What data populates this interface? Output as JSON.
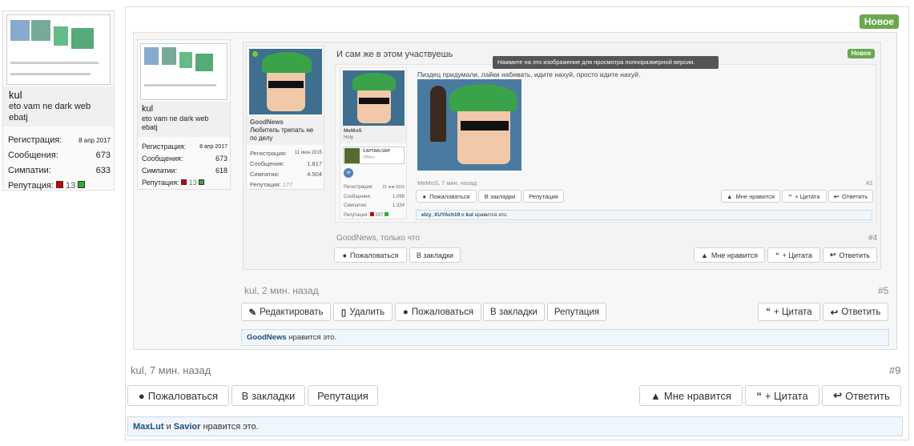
{
  "outer": {
    "badge_new": "Новое",
    "author": {
      "name": "kul",
      "title": "eto vam ne dark web ebatj",
      "stats": [
        {
          "label": "Регистрация:",
          "value": "8 апр 2017"
        },
        {
          "label": "Сообщения:",
          "value": "673"
        },
        {
          "label": "Симпатии:",
          "value": "633"
        }
      ],
      "reputation_label": "Репутация:",
      "reputation_value": "13"
    },
    "footer": {
      "meta": "kul, 7 мин. назад",
      "post_num": "#9",
      "buttons_left": [
        "Пожаловаться",
        "В закладки",
        "Репутация"
      ],
      "buttons_right": [
        "Мне нравится",
        "+ Цитата",
        "Ответить"
      ],
      "likes_users": [
        "MaxLut",
        "Savior"
      ],
      "likes_and": "и",
      "likes_suffix": "нравится это."
    }
  },
  "level2": {
    "author": {
      "name": "kul",
      "title": "eto vam ne dark web ebatj",
      "stats": [
        {
          "label": "Регистрация:",
          "value": "8 апр 2017"
        },
        {
          "label": "Сообщения:",
          "value": "673"
        },
        {
          "label": "Симпатии:",
          "value": "618"
        }
      ],
      "reputation_label": "Репутация:",
      "reputation_value": "13"
    },
    "footer": {
      "meta": "kul, 2 мин. назад",
      "post_num": "#5",
      "buttons_left": [
        "Редактировать",
        "Удалить",
        "Пожаловаться",
        "В закладки",
        "Репутация"
      ],
      "buttons_right": [
        "+ Цитата",
        "Ответить"
      ],
      "likes_user": "GoodNews",
      "likes_suffix": "нравится это."
    }
  },
  "level3": {
    "badge_new": "Новое",
    "text": "И сам же в этом участвуешь",
    "tooltip": "Нажмите на это изображение для просмотра полноразмерной версии.",
    "author": {
      "name": "GoodNews",
      "title": "Любитель трепать не по делу",
      "stats": [
        {
          "label": "Регистрация:",
          "value": "11 июн 2015"
        },
        {
          "label": "Сообщения:",
          "value": "1.817"
        },
        {
          "label": "Симпатии:",
          "value": "4.504"
        }
      ],
      "reputation_label": "Репутация:",
      "reputation_value": "177"
    },
    "footer": {
      "meta": "GoodNews, только что",
      "post_num": "#4",
      "buttons_left": [
        "Пожаловаться",
        "В закладки"
      ],
      "buttons_right": [
        "Мне нравится",
        "+ Цитата",
        "Ответить"
      ]
    }
  },
  "level4": {
    "text": "Пиздец придумали, лайки набивать, идите нахуй, просто идите нахуй.",
    "author": {
      "name": "MeMoS",
      "title": "Holy",
      "game_card": "CAPTAIN GRP",
      "game_status": "Offline",
      "stats": [
        {
          "label": "Регистрация:",
          "value": "21 янв 2015"
        },
        {
          "label": "Сообщения:",
          "value": "1.068"
        },
        {
          "label": "Симпатии:",
          "value": "1.324"
        }
      ],
      "reputation_label": "Репутация:",
      "reputation_value": "207"
    },
    "footer": {
      "meta": "MeMoS, 7 мин. назад",
      "post_num": "#2",
      "buttons_left": [
        "Пожаловаться",
        "В закладки",
        "Репутация"
      ],
      "buttons_right": [
        "Мне нравится",
        "+ Цитата",
        "Ответить"
      ],
      "likes_users": [
        "elzy",
        "XUYAch19"
      ],
      "likes_and": "и",
      "likes_user3": "kul",
      "likes_suffix": "нравится это."
    }
  },
  "icons": {
    "report": "exclamation-circle-icon",
    "like": "thumbs-up-icon",
    "quote": "quote-icon",
    "reply": "reply-arrow-icon",
    "edit": "pencil-icon",
    "delete": "trash-icon",
    "vk": "vk-icon"
  },
  "colors": {
    "badge": "#6aa84f",
    "link": "#1f4e79",
    "likes_bg": "#f0f6fb"
  }
}
